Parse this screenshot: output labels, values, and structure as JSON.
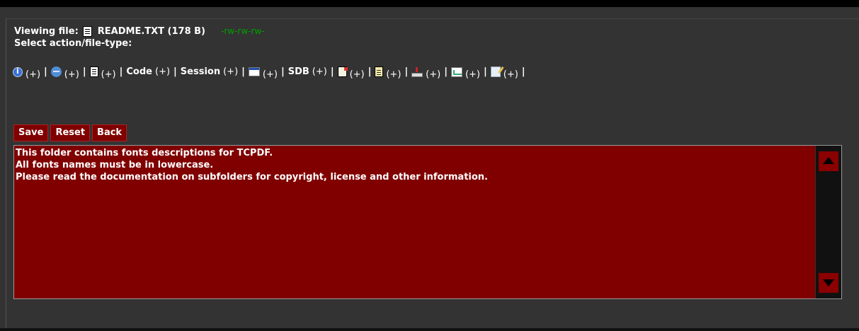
{
  "viewer": {
    "viewing_label": "Viewing file:",
    "file_name": "README.TXT (178 B)",
    "permissions": "-rw-rw-rw-",
    "select_label": "Select action/file-type:"
  },
  "actions": [
    {
      "icon": "info-icon",
      "label": "",
      "plus": "(+)"
    },
    {
      "icon": "ie-icon",
      "label": "",
      "plus": "(+)"
    },
    {
      "icon": "text-file-icon",
      "label": "",
      "plus": "(+)"
    },
    {
      "icon": "",
      "label": "Code",
      "plus": "(+)"
    },
    {
      "icon": "",
      "label": "Session",
      "plus": "(+)"
    },
    {
      "icon": "window-icon",
      "label": "",
      "plus": "(+)"
    },
    {
      "icon": "",
      "label": "SDB",
      "plus": "(+)"
    },
    {
      "icon": "spreadsheet-icon",
      "label": "",
      "plus": "(+)"
    },
    {
      "icon": "notepad-icon",
      "label": "",
      "plus": "(+)"
    },
    {
      "icon": "download-icon",
      "label": "",
      "plus": "(+)"
    },
    {
      "icon": "chart-edit-icon",
      "label": "",
      "plus": "(+)"
    },
    {
      "icon": "edit-icon",
      "label": "",
      "plus": "(+)"
    }
  ],
  "separator": "|",
  "buttons": {
    "save": "Save",
    "reset": "Reset",
    "back": "Back"
  },
  "editor": {
    "content": "This folder contains fonts descriptions for TCPDF.\nAll fonts names must be in lowercase.\nPlease read the documentation on subfolders for copyright, license and other information."
  },
  "colors": {
    "background": "#333333",
    "editor_bg": "#800000",
    "permissions": "#00a000"
  }
}
